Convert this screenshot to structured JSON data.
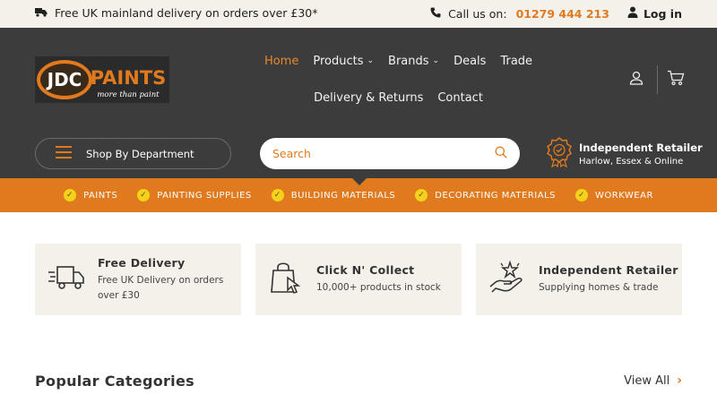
{
  "topbar": {
    "delivery_text": "Free UK mainland delivery on orders over £30*",
    "call_label": "Call us on:",
    "phone": "01279 444 213",
    "login": "Log in"
  },
  "logo": {
    "brand_left": "JDC",
    "brand_right": "PAINTS",
    "tagline": "more than paint"
  },
  "nav": [
    {
      "label": "Home",
      "active": true
    },
    {
      "label": "Products",
      "dropdown": true
    },
    {
      "label": "Brands",
      "dropdown": true
    },
    {
      "label": "Deals"
    },
    {
      "label": "Trade"
    },
    {
      "label": "Delivery & Returns"
    },
    {
      "label": "Contact"
    }
  ],
  "shop_by_department": "Shop By Department",
  "search": {
    "placeholder": "Search"
  },
  "retailer": {
    "title": "Independent Retailer",
    "subtitle": "Harlow, Essex & Online"
  },
  "categories": [
    "PAINTS",
    "PAINTING SUPPLIES",
    "BUILDING MATERIALS",
    "DECORATING MATERIALS",
    "WORKWEAR"
  ],
  "features": [
    {
      "icon": "delivery-truck-icon",
      "title": "Free Delivery",
      "desc": "Free UK Delivery on orders over £30"
    },
    {
      "icon": "shopping-bag-icon",
      "title": "Click N' Collect",
      "desc": "10,000+ products in stock"
    },
    {
      "icon": "hand-star-icon",
      "title": "Independent Retailer",
      "desc": "Supplying homes & trade"
    }
  ],
  "popular": {
    "title": "Popular Categories",
    "view_all": "View All"
  },
  "colors": {
    "accent": "#e07a1f",
    "header_bg": "#3c3c3c",
    "cream": "#f4f1ea",
    "tick": "#f3d21c"
  }
}
